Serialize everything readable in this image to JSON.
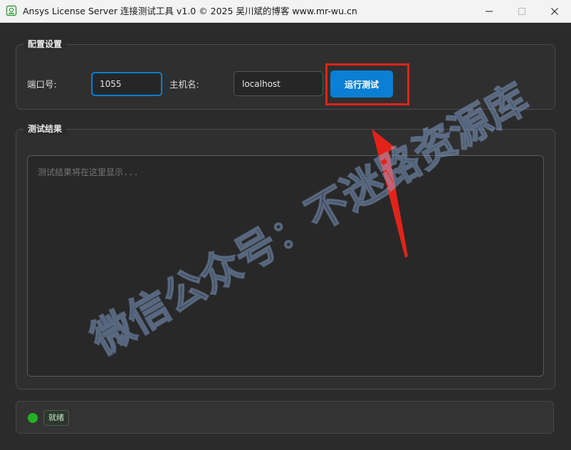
{
  "window": {
    "title": "Ansys License Server 连接测试工具 v1.0 © 2025 吴川斌的博客 www.mr-wu.cn",
    "icon": "app-icon",
    "controls": [
      "minimize-icon",
      "maximize-icon",
      "close-icon"
    ]
  },
  "config": {
    "title": "配置设置",
    "port_label": "端口号:",
    "port_value": "1055",
    "host_label": "主机名:",
    "host_value": "localhost",
    "run_button": "运行测试"
  },
  "result": {
    "title": "测试结果",
    "placeholder": "测试结果将在这里显示..."
  },
  "status": {
    "text": "就绪",
    "color": "#23b024"
  },
  "watermark": {
    "text": "微信公众号：不迷路资源库"
  },
  "colors": {
    "accent": "#0a7fd3",
    "highlight": "#e2231a",
    "background": "#2b2b2b"
  }
}
